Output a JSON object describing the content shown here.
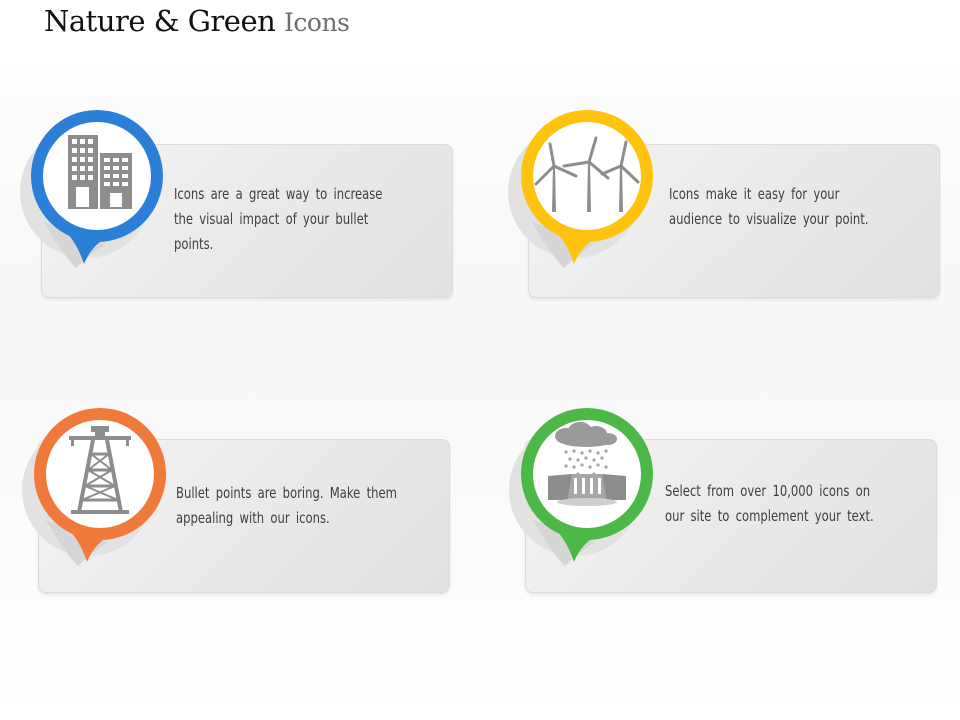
{
  "header": {
    "title_main": "Nature & Green",
    "title_accent": "Icons"
  },
  "colors": {
    "blue": "#2b7fd7",
    "yellow": "#ffc20e",
    "orange": "#f07a3c",
    "green": "#4cb848",
    "icon_gray": "#8d8d8d"
  },
  "cards": [
    {
      "color": "blue",
      "icon": "buildings-icon",
      "text": "Icons are a great way to increase the visual impact of your bullet points."
    },
    {
      "color": "yellow",
      "icon": "wind-turbines-icon",
      "text": "Icons make it easy for your audience to visualize your point."
    },
    {
      "color": "orange",
      "icon": "oil-rig-tower-icon",
      "text": "Bullet points are boring. Make them appealing with our icons."
    },
    {
      "color": "green",
      "icon": "acid-rain-dam-icon",
      "text": "Select from over 10,000 icons on our site to complement your text."
    }
  ]
}
